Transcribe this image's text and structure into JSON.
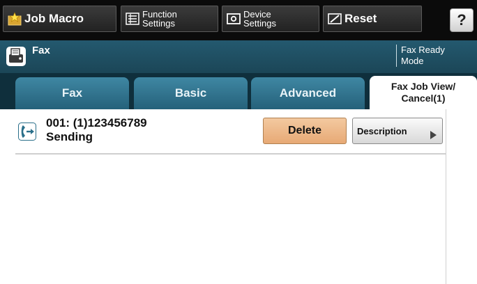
{
  "toolbar": {
    "job_macro": "Job Macro",
    "function_settings": "Function\nSettings",
    "device_settings": "Device\nSettings",
    "reset": "Reset",
    "help": "?"
  },
  "modebar": {
    "title": "Fax",
    "status": "Fax Ready\nMode"
  },
  "tabs": [
    {
      "label": "Fax"
    },
    {
      "label": "Basic"
    },
    {
      "label": "Advanced"
    },
    {
      "label": "Fax Job View/\nCancel(1)"
    }
  ],
  "jobs": [
    {
      "number_line": "001: (1)123456789",
      "status": "Sending",
      "delete_label": "Delete",
      "description_label": "Description"
    }
  ],
  "icons": {
    "job_macro": "star-folder-icon",
    "function_settings": "list-icon",
    "device_settings": "device-icon",
    "reset": "eraser-icon",
    "mode": "fax-icon",
    "job": "phone-send-icon"
  },
  "colors": {
    "toolbar_bg": "#0b0b0b",
    "modebar_bg": "#1b4657",
    "tab_bg": "#25617a",
    "delete_bg": "#e7a975"
  }
}
